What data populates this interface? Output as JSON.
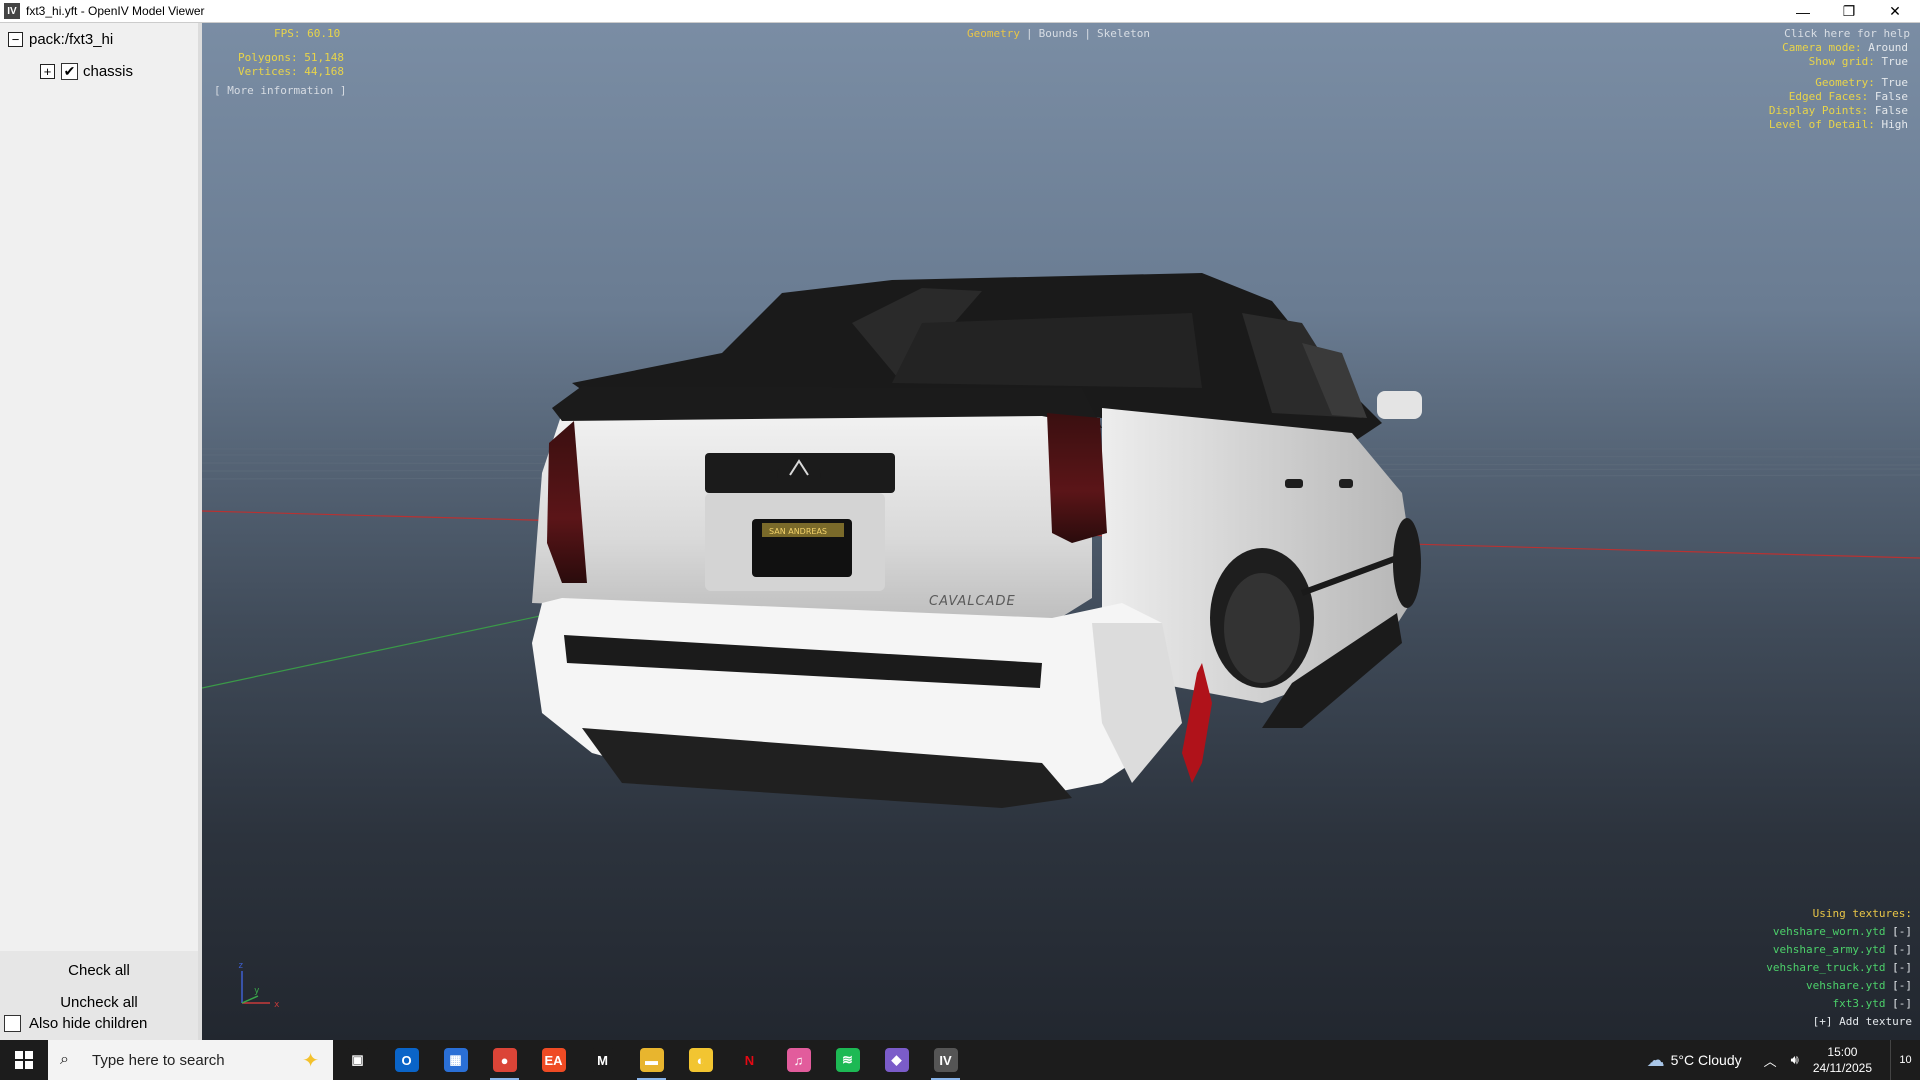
{
  "window": {
    "title": "fxt3_hi.yft - OpenIV Model Viewer",
    "icon_label": "IV",
    "minimize_glyph": "—",
    "maximize_glyph": "❐",
    "close_glyph": "✕"
  },
  "tree": {
    "root": {
      "label": "pack:/fxt3_hi",
      "expander": "−"
    },
    "child": {
      "label": "chassis",
      "expander": "+",
      "checked_glyph": "✔"
    }
  },
  "panel": {
    "check_all": "Check all",
    "uncheck_all": "Uncheck all",
    "also_hide_children": "Also hide children"
  },
  "hud": {
    "fps": "FPS: 60.10",
    "polygons": "Polygons: 51,148",
    "vertices": "Vertices: 44,168",
    "more_info": "[ More information ]",
    "tabs": [
      "Geometry",
      "|",
      "Bounds",
      "|",
      "Skeleton"
    ],
    "help": "Click here for help",
    "options": [
      {
        "key": "Camera mode:",
        "value": "Around"
      },
      {
        "key": "Show grid:",
        "value": "True"
      },
      {
        "key": "Geometry:",
        "value": "True"
      },
      {
        "key": "Edged Faces:",
        "value": "False"
      },
      {
        "key": "Display Points:",
        "value": "False"
      },
      {
        "key": "Level of Detail:",
        "value": "High"
      }
    ],
    "textures_title": "Using textures:",
    "textures": [
      {
        "name": "vehshare_worn.ytd",
        "remove": "[-]"
      },
      {
        "name": "vehshare_army.ytd",
        "remove": "[-]"
      },
      {
        "name": "vehshare_truck.ytd",
        "remove": "[-]"
      },
      {
        "name": "vehshare.ytd",
        "remove": "[-]"
      },
      {
        "name": "fxt3.ytd",
        "remove": "[-]"
      }
    ],
    "add_texture": "[+] Add texture"
  },
  "model": {
    "badge_text": "CAVALCADE",
    "plate_text": "SAN ANDREAS"
  },
  "axis": {
    "x": "x",
    "y": "y",
    "z": "z"
  },
  "taskbar": {
    "search_placeholder": "Type here to search",
    "apps": [
      {
        "name": "task-view",
        "glyph": "▣",
        "color": "#1c1c1c"
      },
      {
        "name": "outlook",
        "glyph": "O",
        "color": "#0a64c8"
      },
      {
        "name": "store",
        "glyph": "▦",
        "color": "#2a6fd6"
      },
      {
        "name": "chrome",
        "glyph": "●",
        "color": "#db4437"
      },
      {
        "name": "ea",
        "glyph": "EA",
        "color": "#ef4b24"
      },
      {
        "name": "m-app",
        "glyph": "M",
        "color": "#1c1c1c"
      },
      {
        "name": "file-explorer",
        "glyph": "▬",
        "color": "#e8b52e"
      },
      {
        "name": "yellow-app",
        "glyph": "◐",
        "color": "#f2c531"
      },
      {
        "name": "netflix",
        "glyph": "N",
        "color": "#1c1c1c"
      },
      {
        "name": "itunes",
        "glyph": "♫",
        "color": "#e25c9c"
      },
      {
        "name": "spotify",
        "glyph": "≋",
        "color": "#1db954"
      },
      {
        "name": "vs-app",
        "glyph": "◆",
        "color": "#7b5cc9"
      },
      {
        "name": "openiv",
        "glyph": "IV",
        "color": "#555555"
      }
    ],
    "weather": "5°C  Cloudy",
    "time": "15:00",
    "date": "24/11/2025",
    "notifications": "10"
  }
}
